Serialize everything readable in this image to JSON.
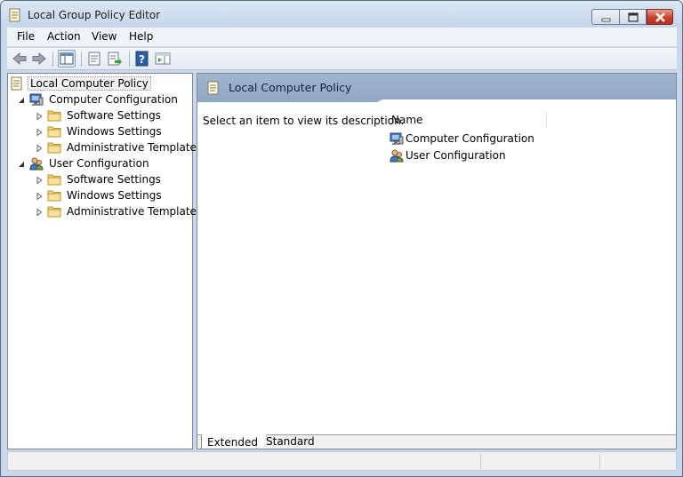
{
  "window": {
    "title": "Local Group Policy Editor",
    "buttons": {
      "minimize": "minimize",
      "maximize": "maximize",
      "close": "close"
    }
  },
  "menu": {
    "items": [
      "File",
      "Action",
      "View",
      "Help"
    ]
  },
  "toolbar": {
    "icons": [
      "back-arrow-icon",
      "forward-arrow-icon",
      "show-hide-tree-icon",
      "properties-icon",
      "export-list-icon",
      "help-icon",
      "action-pane-icon"
    ]
  },
  "tree": {
    "root": "Local Computer Policy",
    "computer": {
      "label": "Computer Configuration",
      "children": [
        "Software Settings",
        "Windows Settings",
        "Administrative Templates"
      ]
    },
    "user": {
      "label": "User Configuration",
      "children": [
        "Software Settings",
        "Windows Settings",
        "Administrative Templates"
      ]
    }
  },
  "details": {
    "title": "Local Computer Policy",
    "description": "Select an item to view its description.",
    "column_name": "Name",
    "rows": [
      "Computer Configuration",
      "User Configuration"
    ],
    "tabs": [
      "Extended",
      "Standard"
    ]
  },
  "colors": {
    "header_blue": "#97afcb",
    "frame": "#c9d8ea",
    "close_red": "#c8402d"
  }
}
